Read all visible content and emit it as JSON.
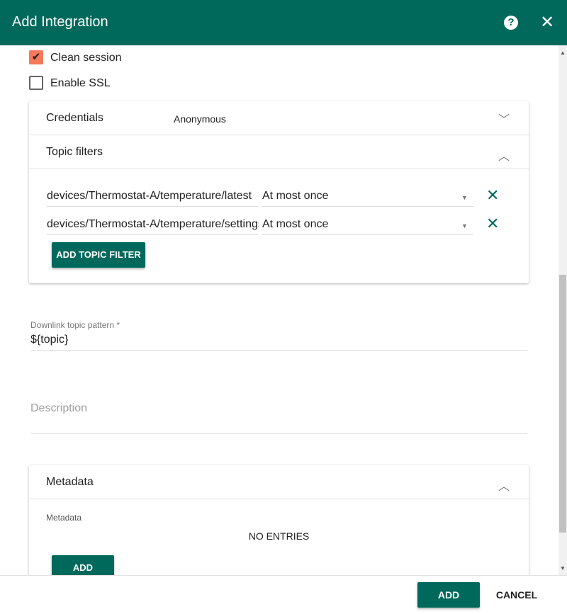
{
  "dialog": {
    "title": "Add Integration",
    "help_icon": "help-circle-icon",
    "close_icon": "close-icon"
  },
  "options": {
    "clean_session": {
      "label": "Clean session",
      "checked": true
    },
    "enable_ssl": {
      "label": "Enable SSL",
      "checked": false
    }
  },
  "credentials": {
    "label": "Credentials",
    "value": "Anonymous"
  },
  "topic_filters": {
    "label": "Topic filters",
    "rows": [
      {
        "filter": "devices/Thermostat-A/temperature/latest",
        "qos": "At most once"
      },
      {
        "filter": "devices/Thermostat-A/temperature/settings",
        "qos": "At most once"
      }
    ],
    "add_label": "ADD TOPIC FILTER"
  },
  "downlink": {
    "label": "Downlink topic pattern *",
    "value": "${topic}"
  },
  "description": {
    "placeholder": "Description"
  },
  "metadata": {
    "label": "Metadata",
    "sublabel": "Metadata",
    "empty": "NO ENTRIES",
    "add_label": "ADD"
  },
  "footer": {
    "add": "ADD",
    "cancel": "CANCEL"
  },
  "colors": {
    "primary": "#00695c",
    "checkbox": "#f4785a"
  }
}
